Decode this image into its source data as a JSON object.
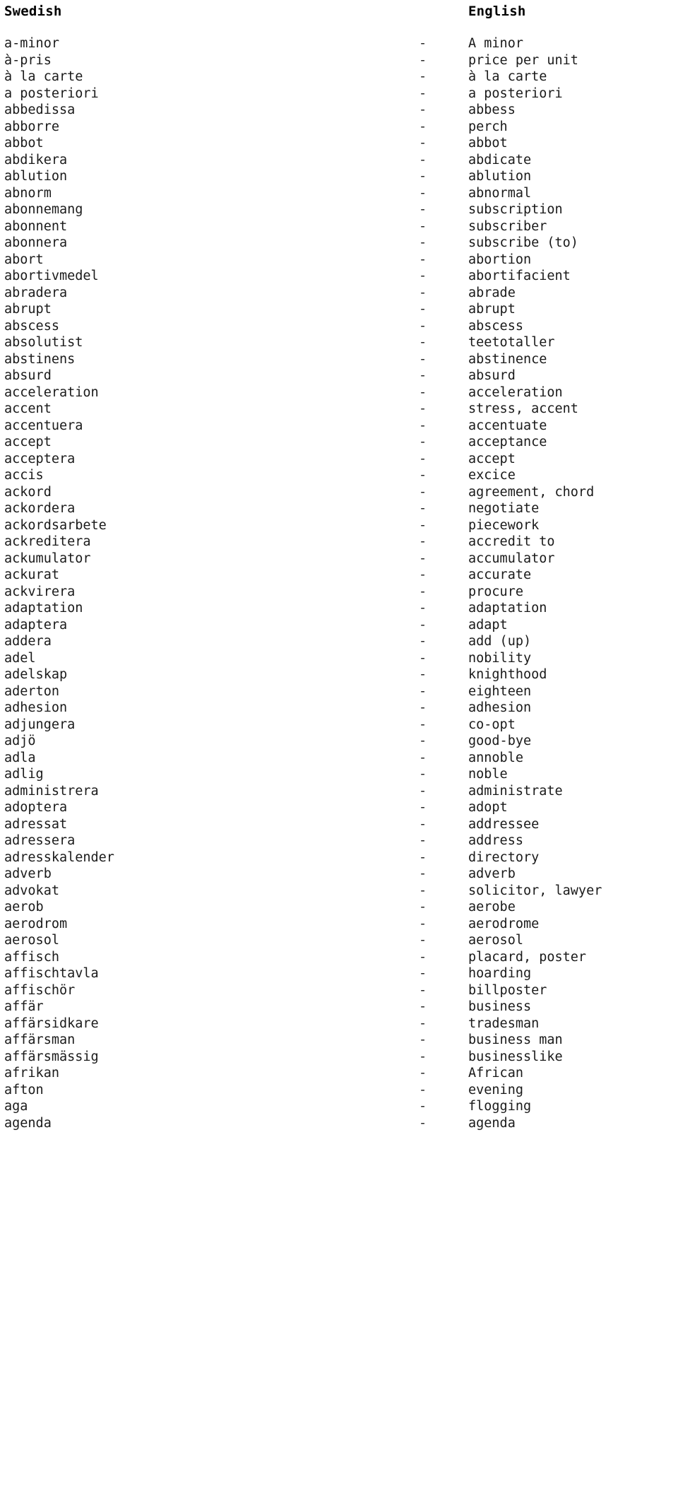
{
  "header": {
    "source_language": "Swedish",
    "target_language": "English"
  },
  "separator": "-",
  "entries": [
    {
      "sv": "a-minor",
      "en": "A minor"
    },
    {
      "sv": "à-pris",
      "en": "price per unit"
    },
    {
      "sv": "à la carte",
      "en": "à la carte"
    },
    {
      "sv": "a posteriori",
      "en": "a posteriori"
    },
    {
      "sv": "abbedissa",
      "en": "abbess"
    },
    {
      "sv": "abborre",
      "en": "perch"
    },
    {
      "sv": "abbot",
      "en": "abbot"
    },
    {
      "sv": "abdikera",
      "en": "abdicate"
    },
    {
      "sv": "ablution",
      "en": "ablution"
    },
    {
      "sv": "abnorm",
      "en": "abnormal"
    },
    {
      "sv": "abonnemang",
      "en": "subscription"
    },
    {
      "sv": "abonnent",
      "en": "subscriber"
    },
    {
      "sv": "abonnera",
      "en": "subscribe (to)"
    },
    {
      "sv": "abort",
      "en": "abortion"
    },
    {
      "sv": "abortivmedel",
      "en": "abortifacient"
    },
    {
      "sv": "abradera",
      "en": "abrade"
    },
    {
      "sv": "abrupt",
      "en": "abrupt"
    },
    {
      "sv": "abscess",
      "en": "abscess"
    },
    {
      "sv": "absolutist",
      "en": "teetotaller"
    },
    {
      "sv": "abstinens",
      "en": "abstinence"
    },
    {
      "sv": "absurd",
      "en": "absurd"
    },
    {
      "sv": "acceleration",
      "en": "acceleration"
    },
    {
      "sv": "accent",
      "en": "stress, accent"
    },
    {
      "sv": "accentuera",
      "en": "accentuate"
    },
    {
      "sv": "accept",
      "en": "acceptance"
    },
    {
      "sv": "acceptera",
      "en": "accept"
    },
    {
      "sv": "accis",
      "en": "excice"
    },
    {
      "sv": "ackord",
      "en": "agreement, chord"
    },
    {
      "sv": "ackordera",
      "en": "negotiate"
    },
    {
      "sv": "ackordsarbete",
      "en": "piecework"
    },
    {
      "sv": "ackreditera",
      "en": "accredit to"
    },
    {
      "sv": "ackumulator",
      "en": "accumulator"
    },
    {
      "sv": "ackurat",
      "en": "accurate"
    },
    {
      "sv": "ackvirera",
      "en": "procure"
    },
    {
      "sv": "adaptation",
      "en": "adaptation"
    },
    {
      "sv": "adaptera",
      "en": "adapt"
    },
    {
      "sv": "addera",
      "en": "add (up)"
    },
    {
      "sv": "adel",
      "en": "nobility"
    },
    {
      "sv": "adelskap",
      "en": "knighthood"
    },
    {
      "sv": "aderton",
      "en": "eighteen"
    },
    {
      "sv": "adhesion",
      "en": "adhesion"
    },
    {
      "sv": "adjungera",
      "en": "co-opt"
    },
    {
      "sv": "adjö",
      "en": "good-bye"
    },
    {
      "sv": "adla",
      "en": "annoble"
    },
    {
      "sv": "adlig",
      "en": "noble"
    },
    {
      "sv": "administrera",
      "en": "administrate"
    },
    {
      "sv": "adoptera",
      "en": "adopt"
    },
    {
      "sv": "adressat",
      "en": "addressee"
    },
    {
      "sv": "adressera",
      "en": "address"
    },
    {
      "sv": "adresskalender",
      "en": "directory"
    },
    {
      "sv": "adverb",
      "en": "adverb"
    },
    {
      "sv": "advokat",
      "en": "solicitor, lawyer"
    },
    {
      "sv": "aerob",
      "en": "aerobe"
    },
    {
      "sv": "aerodrom",
      "en": "aerodrome"
    },
    {
      "sv": "aerosol",
      "en": "aerosol"
    },
    {
      "sv": "affisch",
      "en": "placard, poster"
    },
    {
      "sv": "affischtavla",
      "en": "hoarding"
    },
    {
      "sv": "affischör",
      "en": "billposter"
    },
    {
      "sv": "affär",
      "en": "business"
    },
    {
      "sv": "affärsidkare",
      "en": "tradesman"
    },
    {
      "sv": "affärsman",
      "en": "business man"
    },
    {
      "sv": "affärsmässig",
      "en": "businesslike"
    },
    {
      "sv": "afrikan",
      "en": "African"
    },
    {
      "sv": "afton",
      "en": "evening"
    },
    {
      "sv": "aga",
      "en": "flogging"
    },
    {
      "sv": "agenda",
      "en": "agenda"
    }
  ]
}
